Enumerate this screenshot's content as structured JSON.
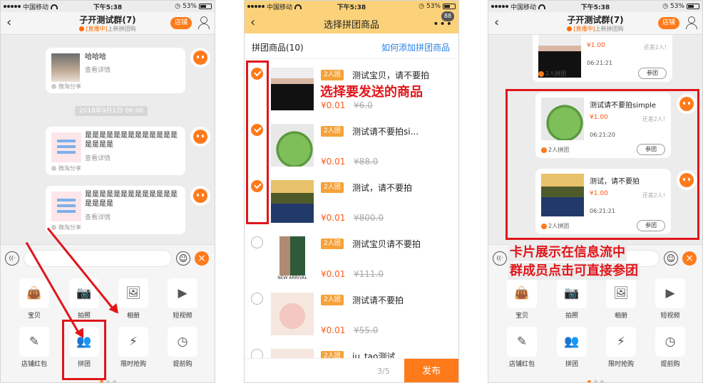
{
  "status": {
    "carrier": "中国移动",
    "time": "下午5:38",
    "battery": "53%"
  },
  "chat": {
    "title": "子开测试群(7)",
    "live_tag": "[直播中]",
    "live_text": "上新拼团购",
    "shop_label": "店铺",
    "date_divider": "2018年9月1日 06:00",
    "messages": [
      {
        "title": "哈哈哈",
        "detail": "查看详情",
        "source": "微淘分享"
      },
      {
        "title": "是是是是是是是是是是是是是是是是是",
        "detail": "查看详情",
        "source": "微淘分享"
      },
      {
        "title": "是是是是是是是是是是是是是是是是是",
        "detail": "查看详情",
        "source": "微淘分享"
      }
    ],
    "input": {
      "voice": "((·",
      "emoji": "☺",
      "plus": "×"
    },
    "panel": [
      {
        "label": "宝贝",
        "icon": "👜"
      },
      {
        "label": "拍照",
        "icon": "📷"
      },
      {
        "label": "相册",
        "icon": "🖼"
      },
      {
        "label": "短视频",
        "icon": "▶"
      },
      {
        "label": "店铺红包",
        "icon": "✎"
      },
      {
        "label": "拼团",
        "icon": "👥"
      },
      {
        "label": "限时抢购",
        "icon": "⚡"
      },
      {
        "label": "提前购",
        "icon": "◷"
      }
    ]
  },
  "select": {
    "title": "选择拼团商品",
    "badge": "88",
    "count_label": "拼团商品(10)",
    "help_link": "如何添加拼团商品",
    "items": [
      {
        "tag": "2人团",
        "name": "测试宝贝，请不要拍",
        "price": "¥0.01",
        "old_price": "¥6.0",
        "checked": true,
        "image": "woman-black"
      },
      {
        "tag": "2人团",
        "name": "测试请不要拍si...",
        "price": "¥0.01",
        "old_price": "¥88.0",
        "checked": true,
        "image": "teapot"
      },
      {
        "tag": "2人团",
        "name": "测试，请不要拍",
        "price": "¥0.01",
        "old_price": "¥800.0",
        "checked": true,
        "image": "lake"
      },
      {
        "tag": "2人团",
        "name": "测试宝贝请不要拍",
        "price": "¥0.01",
        "old_price": "¥111.0",
        "checked": false,
        "image": "woman-green",
        "img_caption": "NEW ARRIVAL"
      },
      {
        "tag": "2人团",
        "name": "测试请不要拍",
        "price": "¥0.01",
        "old_price": "¥55.0",
        "checked": false,
        "image": "woman-flower"
      },
      {
        "tag": "2人团",
        "name": "ju_tao测试",
        "checked": false,
        "image": "woman-flower"
      }
    ],
    "pager": "3/5",
    "publish": "发布",
    "caption": "选择要发送的商品"
  },
  "cards": {
    "items": [
      {
        "name": "",
        "price": "¥1.00",
        "need": "还差2人!",
        "time": "06:21:21",
        "group": "2人拼团",
        "join": "参团"
      },
      {
        "name": "测试请不要拍simple",
        "price": "¥1.00",
        "need": "还差2人!",
        "time": "06:21:20",
        "group": "2人拼团",
        "join": "参团"
      },
      {
        "name": "测试，请不要拍",
        "price": "¥1.00",
        "need": "还差2人!",
        "time": "06:21:21",
        "group": "2人拼团",
        "join": "参团"
      }
    ],
    "caption_line1": "卡片展示在信息流中",
    "caption_line2": "群成员点击可直接参团"
  },
  "colors": {
    "accent": "#ff7a1a",
    "annotation": "#e0161b",
    "header2": "#fbd27a",
    "link": "#2a82e4"
  }
}
